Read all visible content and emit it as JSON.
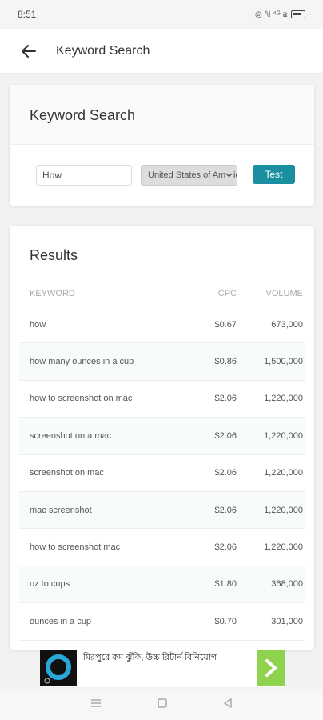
{
  "status": {
    "time": "8:51",
    "icons_text": "◎ ℕ ⁴ᴳ 𝕒"
  },
  "app_bar": {
    "title": "Keyword Search"
  },
  "search": {
    "title": "Keyword Search",
    "keyword_value": "How",
    "country_value": "United States of America",
    "test_label": "Test"
  },
  "results": {
    "title": "Results",
    "headers": {
      "keyword": "KEYWORD",
      "cpc": "CPC",
      "volume": "VOLUME"
    },
    "rows": [
      {
        "keyword": "how",
        "cpc": "$0.67",
        "volume": "673,000"
      },
      {
        "keyword": "how many ounces in a cup",
        "cpc": "$0.86",
        "volume": "1,500,000"
      },
      {
        "keyword": "how to screenshot on mac",
        "cpc": "$2.06",
        "volume": "1,220,000"
      },
      {
        "keyword": "screenshot on a mac",
        "cpc": "$2.06",
        "volume": "1,220,000"
      },
      {
        "keyword": "screenshot on mac",
        "cpc": "$2.06",
        "volume": "1,220,000"
      },
      {
        "keyword": "mac screenshot",
        "cpc": "$2.06",
        "volume": "1,220,000"
      },
      {
        "keyword": "how to screenshot mac",
        "cpc": "$2.06",
        "volume": "1,220,000"
      },
      {
        "keyword": "oz to cups",
        "cpc": "$1.80",
        "volume": "368,000"
      },
      {
        "keyword": "ounces in a cup",
        "cpc": "$0.70",
        "volume": "301,000"
      }
    ]
  },
  "ad": {
    "text": "মিরপুরে কম ঝুঁকি, উচ্চ রিটার্ন বিনিয়োগ"
  },
  "colors": {
    "accent": "#1a8fa0",
    "ad_arrow": "#8ed24e"
  }
}
